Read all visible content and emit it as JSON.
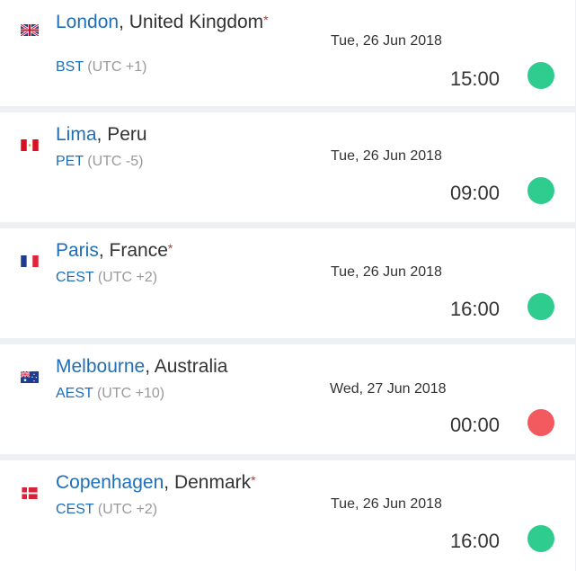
{
  "colors": {
    "link_blue": "#1f6fb8",
    "muted": "#999999",
    "asterisk": "#e0291f",
    "status_ok": "#2ecc8f",
    "status_off": "#f25a5f"
  },
  "cities": [
    {
      "city": "London",
      "country": ", United Kingdom",
      "asterisk": "*",
      "flag": "uk-flag-icon",
      "tz_abbr": "BST",
      "tz_offset": " (UTC +1)",
      "date": "Tue, 26 Jun 2018",
      "time": "15:00",
      "status": "green"
    },
    {
      "city": "Lima",
      "country": ", Peru",
      "asterisk": "",
      "flag": "peru-flag-icon",
      "tz_abbr": "PET",
      "tz_offset": " (UTC -5)",
      "date": "Tue, 26 Jun 2018",
      "time": "09:00",
      "status": "green"
    },
    {
      "city": "Paris",
      "country": ", France",
      "asterisk": "*",
      "flag": "france-flag-icon",
      "tz_abbr": "CEST",
      "tz_offset": " (UTC +2)",
      "date": "Tue, 26 Jun 2018",
      "time": "16:00",
      "status": "green"
    },
    {
      "city": "Melbourne",
      "country": ", Australia",
      "asterisk": "",
      "flag": "australia-flag-icon",
      "tz_abbr": "AEST",
      "tz_offset": " (UTC +10)",
      "date": "Wed, 27 Jun 2018",
      "time": "00:00",
      "status": "red"
    },
    {
      "city": "Copenhagen",
      "country": ", Denmark",
      "asterisk": "*",
      "flag": "denmark-flag-icon",
      "tz_abbr": "CEST",
      "tz_offset": " (UTC +2)",
      "date": "Tue, 26 Jun 2018",
      "time": "16:00",
      "status": "green"
    }
  ]
}
